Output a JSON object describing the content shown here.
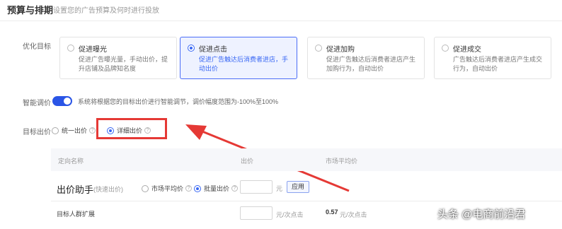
{
  "header": {
    "title": "预算与排期",
    "subtitle": "设置您的广告预算及何时进行投放"
  },
  "optimization": {
    "label": "优化目标",
    "options": [
      {
        "title": "促进曝光",
        "desc": "促进广告曝光量，手动出价，提升店铺及品牌知名度",
        "selected": false
      },
      {
        "title": "促进点击",
        "desc": "促进广告触达后消费者进店，手动出价",
        "selected": true
      },
      {
        "title": "促进加购",
        "desc": "促进广告触达后消费者进店产生加购行为，自动出价",
        "selected": false
      },
      {
        "title": "促进成交",
        "desc": "广告触达后消费者进店产生成交行为，自动出价",
        "selected": false
      }
    ]
  },
  "smart_bid": {
    "label": "智能调价",
    "enabled": true,
    "desc": "系统将根据您的目标出价进行智能调节，调价幅度范围为-100%至100%"
  },
  "target_bid": {
    "label": "目标出价",
    "options": [
      {
        "label": "统一出价",
        "selected": false
      },
      {
        "label": "详细出价",
        "selected": true
      }
    ]
  },
  "table": {
    "headers": [
      "定向名称",
      "出价",
      "市场平均价"
    ]
  },
  "bid_helper": {
    "title": "出价助手",
    "subtitle": "(快速出价)",
    "options": [
      {
        "label": "市场平均价",
        "selected": false
      },
      {
        "label": "批量出价",
        "selected": true
      }
    ],
    "input_value": "",
    "unit": "元",
    "apply_label": "应用"
  },
  "rows": [
    {
      "name": "目标人群扩展",
      "bid_value": "",
      "bid_unit": "元/次点击",
      "avg_value": "0.57",
      "avg_unit": "元/次点击"
    }
  ],
  "watermark": "头条 @电商前沿君",
  "colors": {
    "accent": "#3867f4",
    "highlight": "#e53935"
  }
}
